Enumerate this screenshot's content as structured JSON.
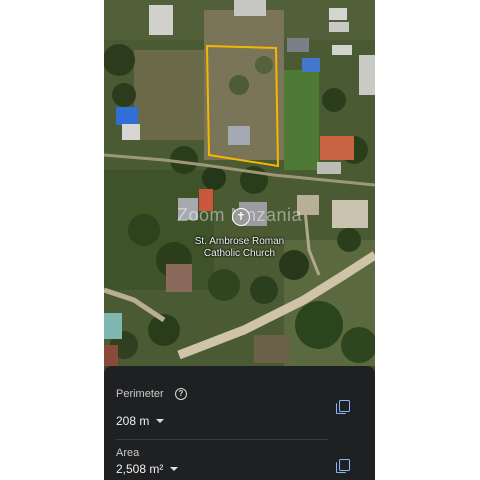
{
  "map": {
    "watermark": "Zoom Mnzania",
    "place_name_line1": "St. Ambrose Roman",
    "place_name_line2": "Catholic Church",
    "selection_color": "#f5b800"
  },
  "measure": {
    "perimeter_label": "Perimeter",
    "perimeter_value": "208 m",
    "area_label": "Area",
    "area_value": "2,508 m²",
    "help_glyph": "?",
    "copy_icon": "copy-icon",
    "accent_color": "#8ab4f8"
  }
}
